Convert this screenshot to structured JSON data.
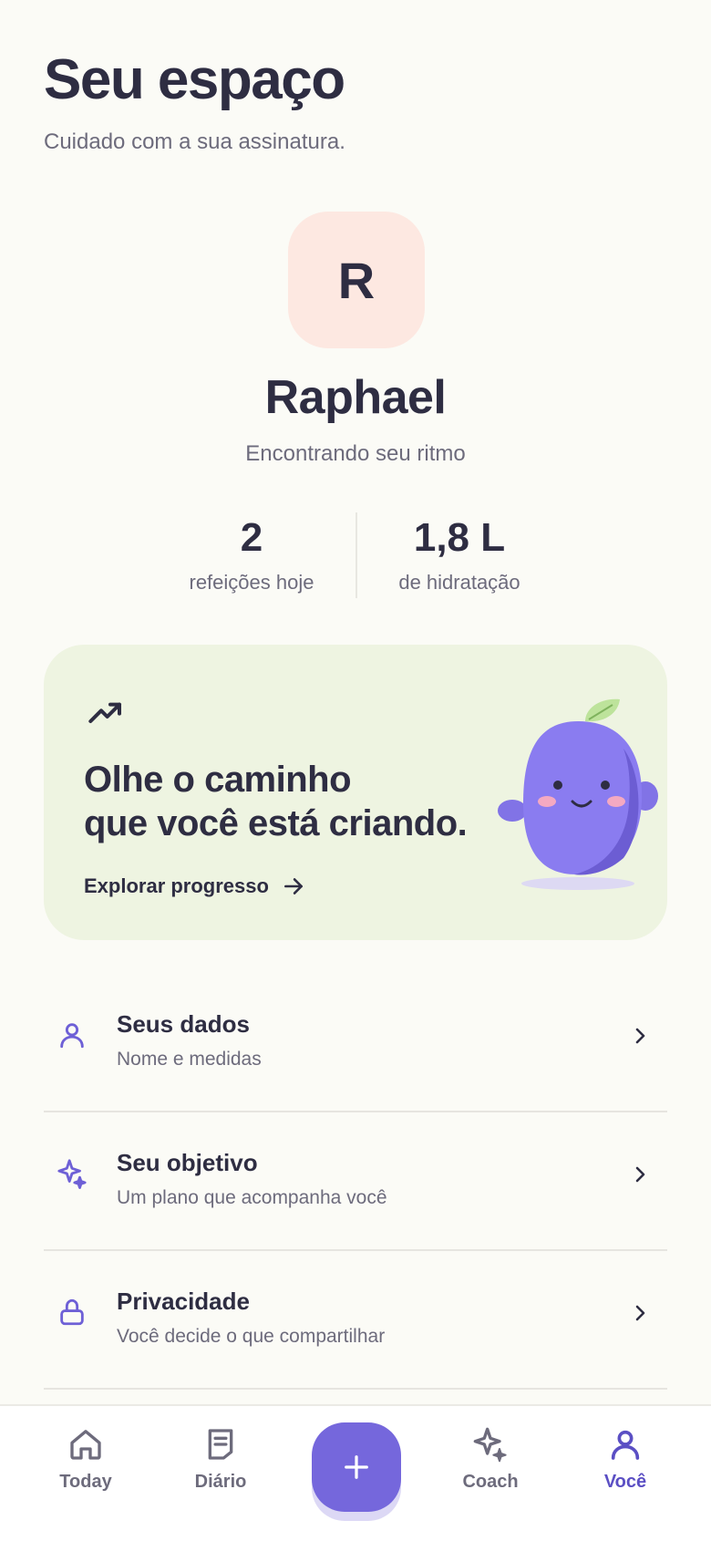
{
  "header": {
    "title": "Seu espaço",
    "subtitle": "Cuidado com a sua assinatura."
  },
  "profile": {
    "avatar_initial": "R",
    "name": "Raphael",
    "status": "Encontrando seu ritmo",
    "avatar_color": "#fde8e1"
  },
  "stats": [
    {
      "value": "2",
      "label": "refeições hoje"
    },
    {
      "value": "1,8 L",
      "label": "de hidratação"
    }
  ],
  "progress_card": {
    "title_line1": "Olhe o caminho",
    "title_line2": "que você está criando.",
    "link_label": "Explorar progresso",
    "icon": "trending-up-icon",
    "background": "#eef4e1"
  },
  "menu": [
    {
      "title": "Seus dados",
      "subtitle": "Nome e medidas",
      "icon": "user-icon"
    },
    {
      "title": "Seu objetivo",
      "subtitle": "Um plano que acompanha você",
      "icon": "sparkle-icon"
    },
    {
      "title": "Privacidade",
      "subtitle": "Você decide o que compartilhar",
      "icon": "lock-icon"
    }
  ],
  "nav": {
    "items": [
      {
        "label": "Today",
        "icon": "home-icon"
      },
      {
        "label": "Diário",
        "icon": "journal-icon"
      },
      {
        "label": "Coach",
        "icon": "sparkle-icon"
      },
      {
        "label": "Você",
        "icon": "user-icon",
        "active": true
      }
    ],
    "add_icon": "plus-icon"
  },
  "colors": {
    "accent": "#7567dc",
    "active_nav": "#5b4fc4",
    "text": "#2e2d42",
    "muted": "#6d6b7c",
    "background": "#fbfbf6"
  }
}
